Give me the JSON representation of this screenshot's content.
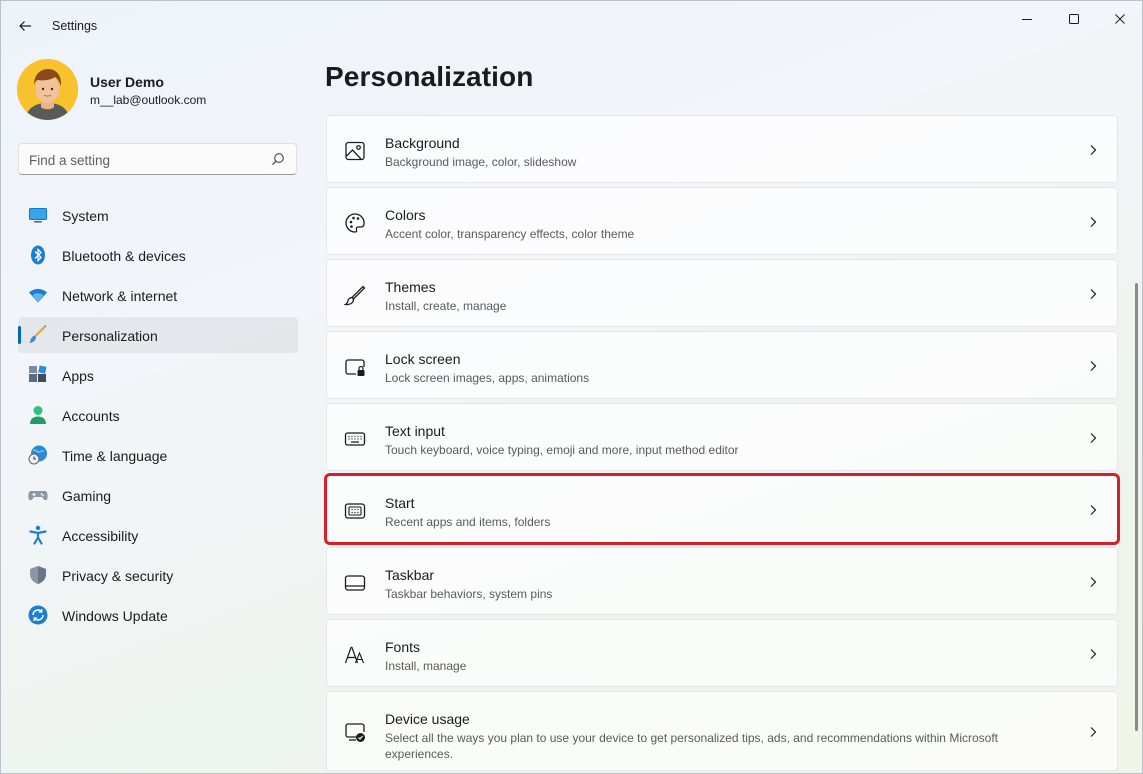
{
  "window": {
    "title": "Settings"
  },
  "profile": {
    "name": "User Demo",
    "email": "m__lab@outlook.com"
  },
  "search": {
    "placeholder": "Find a setting"
  },
  "nav": {
    "items": [
      {
        "label": "System",
        "icon": "system-icon"
      },
      {
        "label": "Bluetooth & devices",
        "icon": "bluetooth-icon"
      },
      {
        "label": "Network & internet",
        "icon": "wifi-icon"
      },
      {
        "label": "Personalization",
        "icon": "brush-icon",
        "active": true
      },
      {
        "label": "Apps",
        "icon": "apps-icon"
      },
      {
        "label": "Accounts",
        "icon": "accounts-icon"
      },
      {
        "label": "Time & language",
        "icon": "globe-clock-icon"
      },
      {
        "label": "Gaming",
        "icon": "gamepad-icon"
      },
      {
        "label": "Accessibility",
        "icon": "accessibility-icon"
      },
      {
        "label": "Privacy & security",
        "icon": "shield-icon"
      },
      {
        "label": "Windows Update",
        "icon": "update-icon"
      }
    ]
  },
  "main": {
    "title": "Personalization",
    "cards": [
      {
        "title": "Background",
        "desc": "Background image, color, slideshow",
        "icon": "image-icon"
      },
      {
        "title": "Colors",
        "desc": "Accent color, transparency effects, color theme",
        "icon": "palette-icon"
      },
      {
        "title": "Themes",
        "desc": "Install, create, manage",
        "icon": "pen-icon"
      },
      {
        "title": "Lock screen",
        "desc": "Lock screen images, apps, animations",
        "icon": "lock-screen-icon"
      },
      {
        "title": "Text input",
        "desc": "Touch keyboard, voice typing, emoji and more, input method editor",
        "icon": "keyboard-icon"
      },
      {
        "title": "Start",
        "desc": "Recent apps and items, folders",
        "icon": "start-icon",
        "highlighted": true
      },
      {
        "title": "Taskbar",
        "desc": "Taskbar behaviors, system pins",
        "icon": "taskbar-icon"
      },
      {
        "title": "Fonts",
        "desc": "Install, manage",
        "icon": "fonts-icon"
      },
      {
        "title": "Device usage",
        "desc": "Select all the ways you plan to use your device to get personalized tips, ads, and recommendations within Microsoft experiences.",
        "icon": "device-usage-icon"
      }
    ]
  },
  "colors": {
    "accent": "#0067c0",
    "highlight": "#d3202a"
  }
}
